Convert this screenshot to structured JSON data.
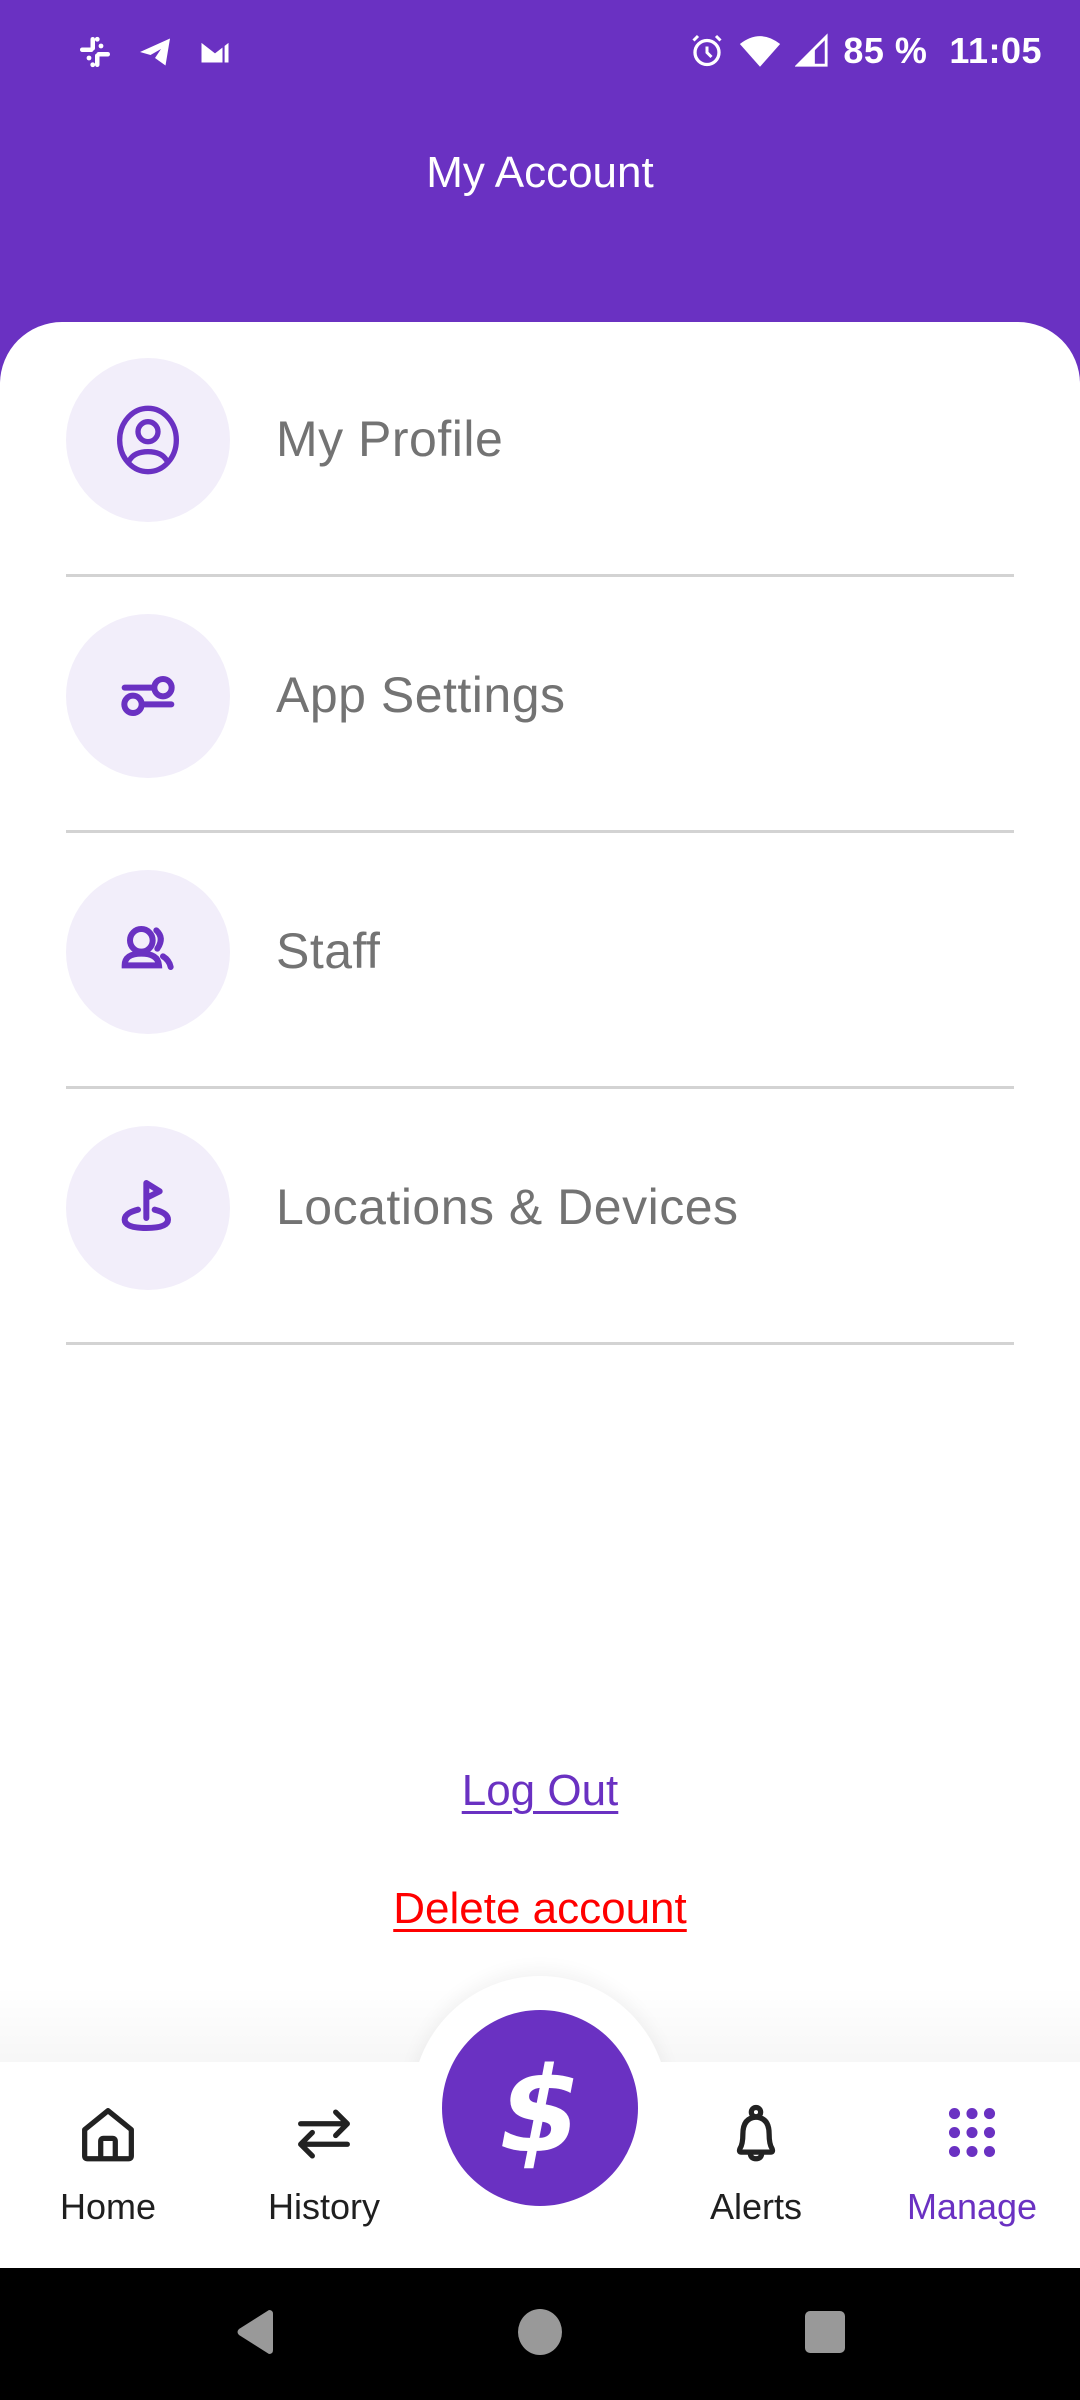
{
  "status_bar": {
    "notification_icons": [
      "slack-icon",
      "telegram-icon",
      "gmail-icon"
    ],
    "system_icons": [
      "alarm-icon",
      "wifi-icon",
      "signal-icon"
    ],
    "battery": "85 %",
    "time": "11:05"
  },
  "header": {
    "title": "My Account"
  },
  "menu": {
    "items": [
      {
        "label": "My Profile",
        "icon": "user-circle-icon"
      },
      {
        "label": "App Settings",
        "icon": "sliders-icon"
      },
      {
        "label": "Staff",
        "icon": "users-icon"
      },
      {
        "label": "Locations & Devices",
        "icon": "location-flag-icon"
      }
    ]
  },
  "actions": {
    "logout_label": "Log Out",
    "delete_label": "Delete account"
  },
  "bottom_nav": {
    "items": [
      {
        "label": "Home",
        "icon": "home-icon",
        "active": false
      },
      {
        "label": "History",
        "icon": "swap-arrows-icon",
        "active": false
      },
      {
        "label": "Alerts",
        "icon": "bell-icon",
        "active": false
      },
      {
        "label": "Manage",
        "icon": "grid-dots-icon",
        "active": true
      }
    ],
    "fab_symbol": "$",
    "fab_icon": "dollar-icon"
  },
  "system_nav": {
    "buttons": [
      "back",
      "home",
      "recents"
    ]
  },
  "colors": {
    "brand": "#6a31c2",
    "icon_bg": "#f2eefa",
    "menu_text": "#737373",
    "danger": "#ff0000",
    "divider": "#d3d3d3"
  }
}
